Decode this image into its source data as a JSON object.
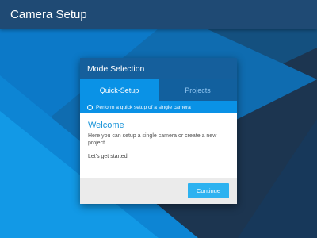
{
  "app": {
    "title": "Camera Setup"
  },
  "dialog": {
    "title": "Mode Selection",
    "tabs": [
      {
        "label": "Quick-Setup",
        "active": true
      },
      {
        "label": "Projects",
        "active": false
      }
    ],
    "info": {
      "icon": "info-icon",
      "text": "Perform a quick setup of a single camera"
    },
    "content": {
      "heading": "Welcome",
      "description": "Here you can setup a single camera or create a new project.",
      "cta": "Let's get started."
    },
    "footer": {
      "button_label": "Continue"
    }
  },
  "colors": {
    "appbar": "#1f4a74",
    "accent": "#0a92e6",
    "header": "#155f9c",
    "button": "#2db2f0",
    "background": "#1c3550"
  }
}
